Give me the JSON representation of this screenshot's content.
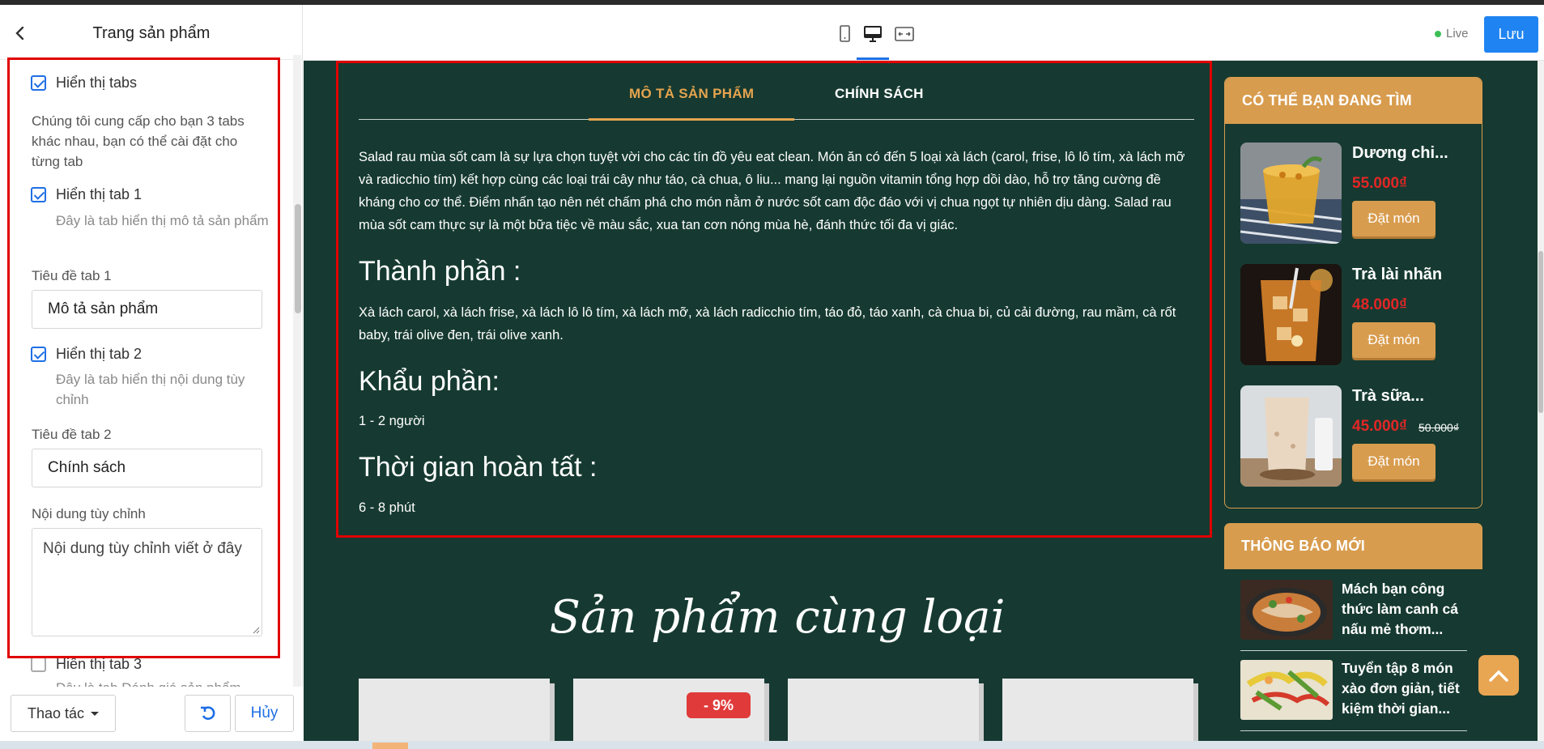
{
  "panel": {
    "title": "Trang sản phẩm",
    "show_tabs_label": "Hiển thị tabs",
    "tabs_description": "Chúng tôi cung cấp cho bạn 3 tabs khác nhau, bạn có thể cài đặt cho từng tab",
    "tab1_show_label": "Hiển thị tab 1",
    "tab1_help": "Đây là tab hiển thị mô tả sản phẩm",
    "tab1_title_label": "Tiêu đề tab 1",
    "tab1_title_value": "Mô tả sản phẩm",
    "tab2_show_label": "Hiển thị tab 2",
    "tab2_help": "Đây là tab hiển thị nội dung tùy chỉnh",
    "tab2_title_label": "Tiêu đề tab 2",
    "tab2_title_value": "Chính sách",
    "custom_content_label": "Nội dung tùy chỉnh",
    "custom_content_value": "Nội dung tùy chỉnh viết ở đây",
    "tab3_show_label": "Hiển thị tab 3",
    "tab3_help": "Đây là tab Đánh giá sản phẩm",
    "actions_label": "Thao tác",
    "cancel_label": "Hủy"
  },
  "toolbar": {
    "live_label": "Live",
    "save_label": "Lưu"
  },
  "product": {
    "tab_active": "MÔ TẢ SẢN PHẨM",
    "tab_inactive": "CHÍNH SÁCH",
    "description": "Salad rau mùa sốt cam là sự lựa chọn tuyệt vời cho các tín đồ yêu eat clean. Món ăn có đến 5 loại xà lách (carol, frise, lô lô tím, xà lách mỡ và radicchio tím) kết hợp cùng các loại trái cây như táo, cà chua, ô liu... mang lại nguồn vitamin tổng hợp dồi dào, hỗ trợ tăng cường đề kháng cho cơ thể. Điểm nhấn tạo nên nét chấm phá cho món nằm ở nước sốt cam độc đáo với vị chua ngọt tự nhiên dịu dàng. Salad rau mùa sốt cam thực sự là một bữa tiệc về màu sắc, xua tan cơn nóng mùa hè, đánh thức tối đa vị giác.",
    "ingredients_heading": "Thành phần :",
    "ingredients": "Xà lách carol, xà lách frise, xà lách lô lô tím, xà lách mỡ, xà lách radicchio tím, táo đỏ, táo xanh, cà chua bi, củ cải đường, rau mầm, cà rốt baby, trái olive đen, trái olive xanh.",
    "portion_heading": "Khẩu phần:",
    "portion": "1 - 2 người",
    "time_heading": "Thời gian hoàn tất :",
    "time": "6 - 8 phút",
    "related_title": "Sản phẩm cùng loại",
    "sale_badge": "- 9%"
  },
  "sidebar": {
    "suggest_title": "CÓ THỂ BẠN ĐANG TÌM",
    "order_label": "Đặt món",
    "items": [
      {
        "name": "Dương chi...",
        "price": "55.000₫",
        "old_price": ""
      },
      {
        "name": "Trà lài nhãn",
        "price": "48.000₫",
        "old_price": ""
      },
      {
        "name": "Trà sữa...",
        "price": "45.000₫",
        "old_price": "50.000₫"
      }
    ],
    "news_title": "THÔNG BÁO MỚI",
    "news": [
      {
        "title": "Mách bạn công thức làm canh cá nấu mẻ thơm..."
      },
      {
        "title": "Tuyển tập 8 món xào đơn giản, tiết kiệm thời gian..."
      }
    ]
  },
  "colors": {
    "preview_bg": "#163a31",
    "accent": "#d89c4e",
    "price": "#e32626",
    "primary": "#1f84f2",
    "highlight_border": "#e00000"
  }
}
